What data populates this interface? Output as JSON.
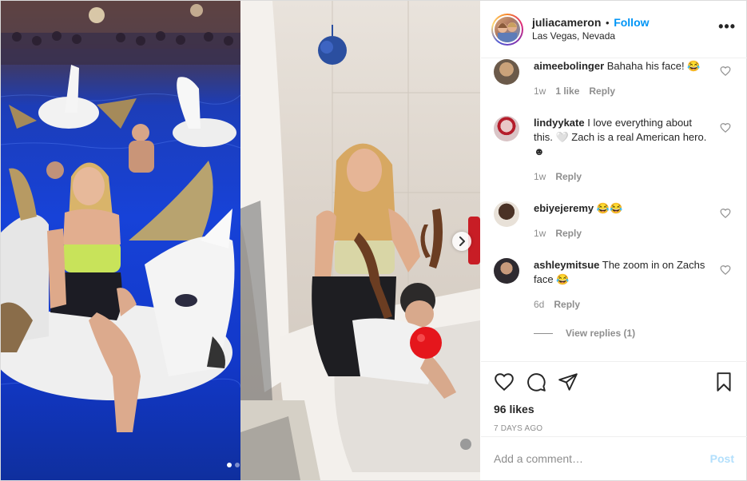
{
  "post": {
    "username": "juliacameron",
    "follow_label": "Follow",
    "location": "Las Vegas, Nevada",
    "more_label": "•••",
    "carousel": {
      "total": 2,
      "active_index": 0
    }
  },
  "comments": [
    {
      "user": "aimeebolinger",
      "text": "Bahaha his face! 😂",
      "time": "1w",
      "likes": "1 like",
      "reply": "Reply",
      "avatar_color": "#6b5a4a"
    },
    {
      "user": "lindyykate",
      "text": "I love everything about this. 🤍 Zach is a real American hero. ☻",
      "time": "1w",
      "likes": "",
      "reply": "Reply",
      "avatar_color": "#c9b7b9"
    },
    {
      "user": "ebiyejeremy",
      "text": "😂😂",
      "time": "1w",
      "likes": "",
      "reply": "Reply",
      "avatar_color": "#4a3a30"
    },
    {
      "user": "ashleymitsue",
      "text": "The zoom in on Zachs face 😂",
      "time": "6d",
      "likes": "",
      "reply": "Reply",
      "avatar_color": "#2e2a30"
    }
  ],
  "view_replies": "View replies (1)",
  "likes_text": "96 likes",
  "timestamp": "7 DAYS AGO",
  "comment_input": {
    "placeholder": "Add a comment…",
    "value": ""
  },
  "post_button": "Post",
  "icons": {
    "like": "heart-icon",
    "comment": "comment-icon",
    "share": "send-icon",
    "save": "bookmark-icon",
    "next": "chevron-right-icon"
  },
  "colors": {
    "link": "#0095f6",
    "muted": "#8e8e8e",
    "post_disabled": "#b2dffc",
    "text": "#262626"
  }
}
